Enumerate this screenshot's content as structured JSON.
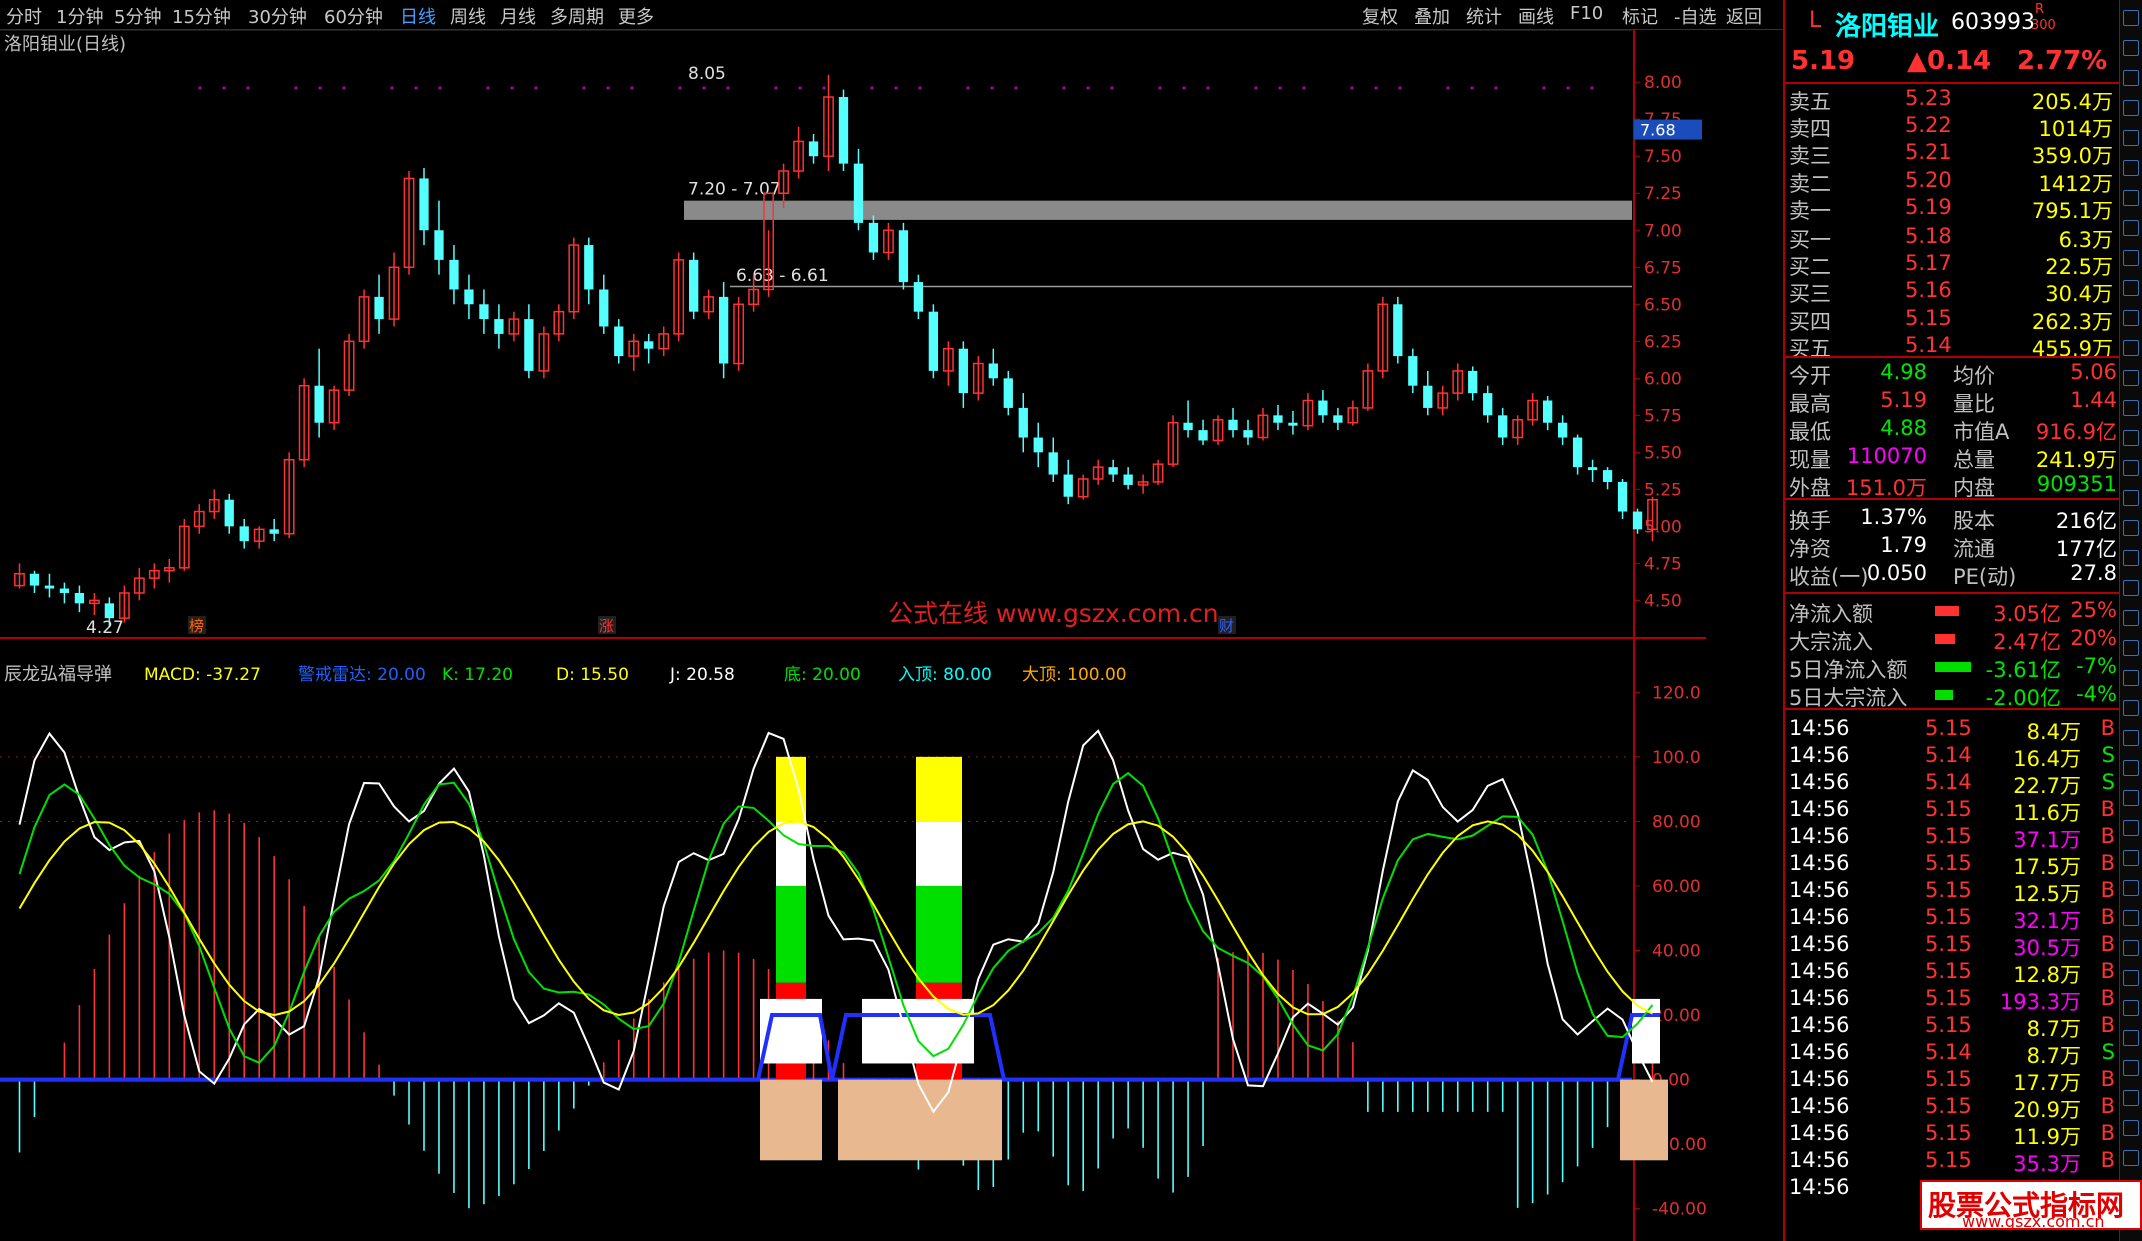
{
  "toolbar": {
    "periods": [
      "分时",
      "1分钟",
      "5分钟",
      "15分钟",
      "30分钟",
      "60分钟",
      "日线",
      "周线",
      "月线",
      "多周期",
      "更多"
    ],
    "active_period": "日线",
    "right_items": [
      "复权",
      "叠加",
      "统计",
      "画线",
      "F10",
      "标记",
      "-自选",
      "返回"
    ]
  },
  "colors": {
    "up": "#ff3232",
    "down": "#54ffff",
    "bg": "#000000",
    "accent_blue": "#3fa0ff"
  },
  "chart_data": [
    {
      "type": "candlestick",
      "title": "洛阳钼业(日线)",
      "ylim": [
        4.3,
        8.15
      ],
      "yticks": [
        "8.00",
        "7.75",
        "7.50",
        "7.25",
        "7.00",
        "6.75",
        "6.50",
        "6.25",
        "6.00",
        "5.75",
        "5.50",
        "5.25",
        "5.00",
        "4.75",
        "4.50"
      ],
      "current_price_tag": "7.68",
      "annotations": {
        "high": "8.05",
        "low": "4.27",
        "zone1": "7.20 - 7.07",
        "zone2": "6.63 - 6.61"
      },
      "markers": [
        "榜",
        "涨",
        "财"
      ],
      "watermark": "公式在线 www.gszx.com.cn",
      "candles": [
        [
          4.6,
          4.75,
          4.58,
          4.68
        ],
        [
          4.68,
          4.7,
          4.55,
          4.6
        ],
        [
          4.6,
          4.68,
          4.52,
          4.58
        ],
        [
          4.58,
          4.62,
          4.48,
          4.55
        ],
        [
          4.55,
          4.6,
          4.42,
          4.48
        ],
        [
          4.48,
          4.55,
          4.4,
          4.5
        ],
        [
          4.48,
          4.52,
          4.32,
          4.38
        ],
        [
          4.38,
          4.6,
          4.35,
          4.55
        ],
        [
          4.55,
          4.72,
          4.5,
          4.65
        ],
        [
          4.65,
          4.75,
          4.58,
          4.7
        ],
        [
          4.7,
          4.78,
          4.62,
          4.72
        ],
        [
          4.72,
          5.05,
          4.7,
          5.0
        ],
        [
          5.0,
          5.15,
          4.95,
          5.1
        ],
        [
          5.1,
          5.25,
          5.05,
          5.18
        ],
        [
          5.18,
          5.22,
          4.95,
          5.0
        ],
        [
          5.0,
          5.05,
          4.85,
          4.9
        ],
        [
          4.9,
          5.0,
          4.85,
          4.98
        ],
        [
          4.98,
          5.05,
          4.9,
          4.95
        ],
        [
          4.95,
          5.5,
          4.92,
          5.45
        ],
        [
          5.45,
          6.0,
          5.4,
          5.95
        ],
        [
          5.95,
          6.2,
          5.6,
          5.7
        ],
        [
          5.7,
          5.95,
          5.65,
          5.92
        ],
        [
          5.92,
          6.3,
          5.88,
          6.25
        ],
        [
          6.25,
          6.6,
          6.2,
          6.55
        ],
        [
          6.55,
          6.7,
          6.3,
          6.4
        ],
        [
          6.4,
          6.85,
          6.35,
          6.75
        ],
        [
          6.75,
          7.4,
          6.7,
          7.35
        ],
        [
          7.35,
          7.42,
          6.9,
          7.0
        ],
        [
          7.0,
          7.2,
          6.7,
          6.8
        ],
        [
          6.8,
          6.9,
          6.5,
          6.6
        ],
        [
          6.6,
          6.7,
          6.4,
          6.5
        ],
        [
          6.5,
          6.6,
          6.3,
          6.4
        ],
        [
          6.4,
          6.5,
          6.2,
          6.3
        ],
        [
          6.3,
          6.45,
          6.25,
          6.4
        ],
        [
          6.4,
          6.5,
          6.0,
          6.05
        ],
        [
          6.05,
          6.35,
          6.0,
          6.3
        ],
        [
          6.3,
          6.5,
          6.25,
          6.45
        ],
        [
          6.45,
          6.95,
          6.4,
          6.9
        ],
        [
          6.9,
          6.95,
          6.5,
          6.6
        ],
        [
          6.6,
          6.7,
          6.3,
          6.35
        ],
        [
          6.35,
          6.4,
          6.1,
          6.15
        ],
        [
          6.15,
          6.3,
          6.05,
          6.25
        ],
        [
          6.25,
          6.3,
          6.1,
          6.2
        ],
        [
          6.2,
          6.35,
          6.15,
          6.3
        ],
        [
          6.3,
          6.85,
          6.25,
          6.8
        ],
        [
          6.8,
          6.85,
          6.4,
          6.45
        ],
        [
          6.45,
          6.6,
          6.4,
          6.55
        ],
        [
          6.55,
          6.65,
          6.0,
          6.1
        ],
        [
          6.1,
          6.55,
          6.05,
          6.5
        ],
        [
          6.5,
          6.7,
          6.45,
          6.6
        ],
        [
          6.6,
          7.0,
          6.55,
          7.25
        ],
        [
          7.25,
          7.45,
          7.15,
          7.4
        ],
        [
          7.4,
          7.7,
          7.35,
          7.6
        ],
        [
          7.6,
          7.65,
          7.45,
          7.5
        ],
        [
          7.5,
          8.05,
          7.4,
          7.9
        ],
        [
          7.9,
          7.95,
          7.4,
          7.45
        ],
        [
          7.45,
          7.55,
          7.0,
          7.05
        ],
        [
          7.05,
          7.1,
          6.8,
          6.85
        ],
        [
          6.85,
          7.05,
          6.8,
          7.0
        ],
        [
          7.0,
          7.05,
          6.6,
          6.65
        ],
        [
          6.65,
          6.7,
          6.4,
          6.45
        ],
        [
          6.45,
          6.5,
          6.0,
          6.05
        ],
        [
          6.05,
          6.25,
          5.95,
          6.2
        ],
        [
          6.2,
          6.25,
          5.8,
          5.9
        ],
        [
          5.9,
          6.15,
          5.85,
          6.1
        ],
        [
          6.1,
          6.2,
          5.95,
          6.0
        ],
        [
          6.0,
          6.05,
          5.75,
          5.8
        ],
        [
          5.8,
          5.9,
          5.5,
          5.6
        ],
        [
          5.6,
          5.7,
          5.4,
          5.5
        ],
        [
          5.5,
          5.6,
          5.3,
          5.35
        ],
        [
          5.35,
          5.45,
          5.15,
          5.2
        ],
        [
          5.2,
          5.35,
          5.18,
          5.32
        ],
        [
          5.32,
          5.45,
          5.28,
          5.4
        ],
        [
          5.4,
          5.45,
          5.3,
          5.35
        ],
        [
          5.35,
          5.4,
          5.25,
          5.28
        ],
        [
          5.28,
          5.35,
          5.22,
          5.3
        ],
        [
          5.3,
          5.45,
          5.28,
          5.42
        ],
        [
          5.42,
          5.75,
          5.4,
          5.7
        ],
        [
          5.7,
          5.85,
          5.6,
          5.65
        ],
        [
          5.65,
          5.72,
          5.55,
          5.58
        ],
        [
          5.58,
          5.75,
          5.55,
          5.72
        ],
        [
          5.72,
          5.8,
          5.6,
          5.65
        ],
        [
          5.65,
          5.72,
          5.55,
          5.6
        ],
        [
          5.6,
          5.8,
          5.58,
          5.75
        ],
        [
          5.75,
          5.82,
          5.65,
          5.7
        ],
        [
          5.7,
          5.78,
          5.62,
          5.68
        ],
        [
          5.68,
          5.9,
          5.65,
          5.85
        ],
        [
          5.85,
          5.92,
          5.7,
          5.75
        ],
        [
          5.75,
          5.8,
          5.65,
          5.7
        ],
        [
          5.7,
          5.85,
          5.68,
          5.8
        ],
        [
          5.8,
          6.1,
          5.78,
          6.05
        ],
        [
          6.05,
          6.55,
          6.0,
          6.5
        ],
        [
          6.5,
          6.55,
          6.1,
          6.15
        ],
        [
          6.15,
          6.2,
          5.9,
          5.95
        ],
        [
          5.95,
          6.05,
          5.75,
          5.8
        ],
        [
          5.8,
          5.95,
          5.75,
          5.9
        ],
        [
          5.9,
          6.1,
          5.85,
          6.05
        ],
        [
          6.05,
          6.08,
          5.85,
          5.9
        ],
        [
          5.9,
          5.95,
          5.7,
          5.75
        ],
        [
          5.75,
          5.8,
          5.55,
          5.6
        ],
        [
          5.6,
          5.75,
          5.55,
          5.72
        ],
        [
          5.72,
          5.9,
          5.68,
          5.85
        ],
        [
          5.85,
          5.88,
          5.65,
          5.7
        ],
        [
          5.7,
          5.75,
          5.55,
          5.6
        ],
        [
          5.6,
          5.62,
          5.35,
          5.4
        ],
        [
          5.4,
          5.45,
          5.3,
          5.38
        ],
        [
          5.38,
          5.4,
          5.25,
          5.3
        ],
        [
          5.3,
          5.32,
          5.05,
          5.1
        ],
        [
          5.1,
          5.12,
          4.95,
          4.98
        ],
        [
          4.98,
          5.2,
          4.9,
          5.18
        ]
      ]
    },
    {
      "type": "indicator",
      "title": "辰龙弘福导弹",
      "legend": [
        {
          "label": "MACD: -37.27",
          "color": "#ffff00"
        },
        {
          "label": "警戒雷达: 20.00",
          "color": "#2060ff"
        },
        {
          "label": "K: 17.20",
          "color": "#00e000"
        },
        {
          "label": "D: 15.50",
          "color": "#ffff00"
        },
        {
          "label": "J: 20.58",
          "color": "#ffffff"
        },
        {
          "label": "底: 20.00",
          "color": "#00e000"
        },
        {
          "label": "入顶: 80.00",
          "color": "#00ffff"
        },
        {
          "label": "大顶: 100.00",
          "color": "#ffaa00"
        }
      ],
      "ylim": [
        -50,
        130
      ],
      "yticks": [
        "120.0",
        "100.0",
        "80.00",
        "60.00",
        "40.00",
        "20.00",
        "0.00",
        "-20.00",
        "-40.00"
      ]
    }
  ],
  "stock": {
    "name": "洛阳钼业",
    "code": "603993",
    "tag_l": "L",
    "tag_r": "R",
    "tag_300": "300",
    "price": "5.19",
    "change": "▲0.14",
    "pct": "2.77%"
  },
  "orderbook": [
    {
      "label": "卖五",
      "price": "5.23",
      "vol": "205.4万"
    },
    {
      "label": "卖四",
      "price": "5.22",
      "vol": "1014万"
    },
    {
      "label": "卖三",
      "price": "5.21",
      "vol": "359.0万"
    },
    {
      "label": "卖二",
      "price": "5.20",
      "vol": "1412万"
    },
    {
      "label": "卖一",
      "price": "5.19",
      "vol": "795.1万"
    },
    {
      "label": "买一",
      "price": "5.18",
      "vol": "6.3万"
    },
    {
      "label": "买二",
      "price": "5.17",
      "vol": "22.5万"
    },
    {
      "label": "买三",
      "price": "5.16",
      "vol": "30.4万"
    },
    {
      "label": "买四",
      "price": "5.15",
      "vol": "262.3万"
    },
    {
      "label": "买五",
      "price": "5.14",
      "vol": "455.9万"
    }
  ],
  "stats": [
    {
      "l1": "今开",
      "v1": "4.98",
      "l2": "均价",
      "v2": "5.06"
    },
    {
      "l1": "最高",
      "v1": "5.19",
      "l2": "量比",
      "v2": "1.44"
    },
    {
      "l1": "最低",
      "v1": "4.88",
      "l2": "市值A",
      "v2": "916.9亿"
    },
    {
      "l1": "现量",
      "v1": "110070",
      "l2": "总量",
      "v2": "241.9万"
    },
    {
      "l1": "外盘",
      "v1": "151.0万",
      "l2": "内盘",
      "v2": "909351"
    }
  ],
  "stats2": [
    {
      "l1": "换手",
      "v1": "1.37%",
      "l2": "股本",
      "v2": "216亿"
    },
    {
      "l1": "净资",
      "v1": "1.79",
      "l2": "流通",
      "v2": "177亿"
    },
    {
      "l1": "收益(一)",
      "v1": "0.050",
      "l2": "PE(动)",
      "v2": "27.8"
    }
  ],
  "flows": [
    {
      "label": "净流入额",
      "value": "3.05亿",
      "pct": "25%",
      "bar": 0.6
    },
    {
      "label": "大宗流入",
      "value": "2.47亿",
      "pct": "20%",
      "bar": 0.5
    },
    {
      "label": "5日净流入额",
      "value": "-3.61亿",
      "pct": "-7%",
      "bar": 0.9
    },
    {
      "label": "5日大宗流入",
      "value": "-2.00亿",
      "pct": "-4%",
      "bar": 0.45
    }
  ],
  "ticks": [
    {
      "time": "14:56",
      "price": "5.15",
      "vol": "8.4万",
      "side": "B"
    },
    {
      "time": "14:56",
      "price": "5.14",
      "vol": "16.4万",
      "side": "S"
    },
    {
      "time": "14:56",
      "price": "5.14",
      "vol": "22.7万",
      "side": "S"
    },
    {
      "time": "14:56",
      "price": "5.15",
      "vol": "11.6万",
      "side": "B"
    },
    {
      "time": "14:56",
      "price": "5.15",
      "vol": "37.1万",
      "side": "B"
    },
    {
      "time": "14:56",
      "price": "5.15",
      "vol": "17.5万",
      "side": "B"
    },
    {
      "time": "14:56",
      "price": "5.15",
      "vol": "12.5万",
      "side": "B"
    },
    {
      "time": "14:56",
      "price": "5.15",
      "vol": "32.1万",
      "side": "B"
    },
    {
      "time": "14:56",
      "price": "5.15",
      "vol": "30.5万",
      "side": "B"
    },
    {
      "time": "14:56",
      "price": "5.15",
      "vol": "12.8万",
      "side": "B"
    },
    {
      "time": "14:56",
      "price": "5.15",
      "vol": "193.3万",
      "side": "B"
    },
    {
      "time": "14:56",
      "price": "5.15",
      "vol": "8.7万",
      "side": "B"
    },
    {
      "time": "14:56",
      "price": "5.14",
      "vol": "8.7万",
      "side": "S"
    },
    {
      "time": "14:56",
      "price": "5.15",
      "vol": "17.7万",
      "side": "B"
    },
    {
      "time": "14:56",
      "price": "5.15",
      "vol": "20.9万",
      "side": "B"
    },
    {
      "time": "14:56",
      "price": "5.15",
      "vol": "11.9万",
      "side": "B"
    },
    {
      "time": "14:56",
      "price": "5.15",
      "vol": "35.3万",
      "side": "B"
    },
    {
      "time": "14:56",
      "price": "",
      "vol": "",
      "side": ""
    }
  ],
  "watermark_box": {
    "line1": "股票公式指标网",
    "line2": "www.gszx.com.cn"
  }
}
